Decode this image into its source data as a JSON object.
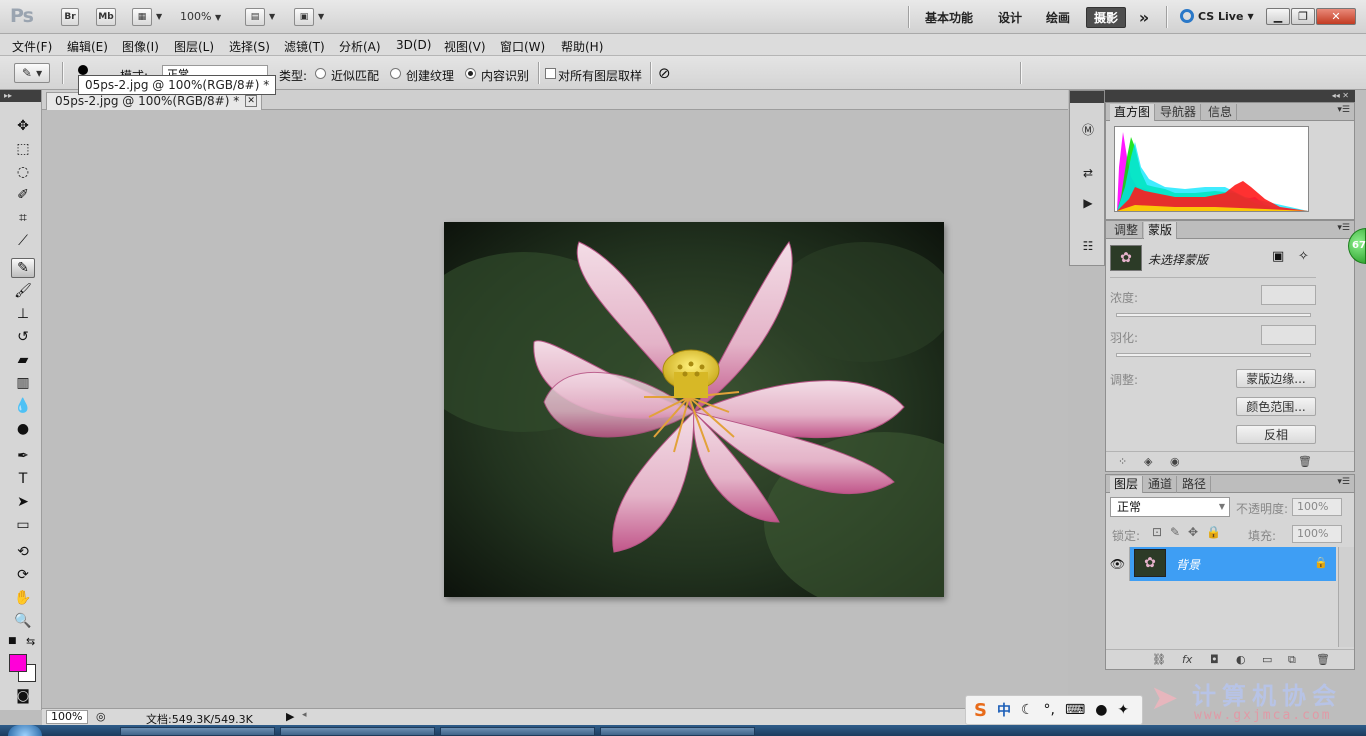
{
  "app": {
    "logo": "Ps",
    "bridge_label": "Br",
    "minibridge_label": "Mb",
    "zoom": "100%",
    "workspaces": [
      {
        "label": "基本功能",
        "active": false
      },
      {
        "label": "设计",
        "active": false
      },
      {
        "label": "绘画",
        "active": false
      },
      {
        "label": "摄影",
        "active": true
      }
    ],
    "overflow": "»",
    "cs_live": "CS Live"
  },
  "menu": [
    "文件(F)",
    "编辑(E)",
    "图像(I)",
    "图层(L)",
    "选择(S)",
    "滤镜(T)",
    "分析(A)",
    "3D(D)",
    "视图(V)",
    "窗口(W)",
    "帮助(H)"
  ],
  "options": {
    "mode_label": "模式:",
    "mode_value": "正常",
    "type_label": "类型:",
    "radios": [
      {
        "label": "近似匹配",
        "checked": false
      },
      {
        "label": "创建纹理",
        "checked": false
      },
      {
        "label": "内容识别",
        "checked": true
      }
    ],
    "sample_all_label": "对所有图层取样"
  },
  "tooltip": "05ps-2.jpg @ 100%(RGB/8#) *",
  "document": {
    "tab_title": "05ps-2.jpg @ 100%(RGB/8#) *",
    "zoom": "100%",
    "doc_size": "文档:549.3K/549.3K"
  },
  "colors": {
    "foreground": "#ff00d8",
    "background": "#ffffff",
    "accent": "#3e9ef4"
  },
  "panels": {
    "top_tabs": [
      "直方图",
      "导航器",
      "信息"
    ],
    "mask_tabs": [
      "调整",
      "蒙版"
    ],
    "mask": {
      "selection_label": "未选择蒙版",
      "density_label": "浓度:",
      "feather_label": "羽化:",
      "refine_label": "调整:",
      "buttons": [
        "蒙版边缘...",
        "颜色范围...",
        "反相"
      ]
    },
    "layer_tabs": [
      "图层",
      "通道",
      "路径"
    ],
    "layers": {
      "blend_mode": "正常",
      "opacity_label": "不透明度:",
      "opacity_value": "100%",
      "lock_label": "锁定:",
      "fill_label": "填充:",
      "fill_value": "100%",
      "items": [
        {
          "name": "背景",
          "selected": true
        }
      ]
    }
  },
  "ime": {
    "zh": "中"
  },
  "watermark": {
    "title": "计算机协会",
    "url": "www.gxjmca.com"
  },
  "badge": "67"
}
